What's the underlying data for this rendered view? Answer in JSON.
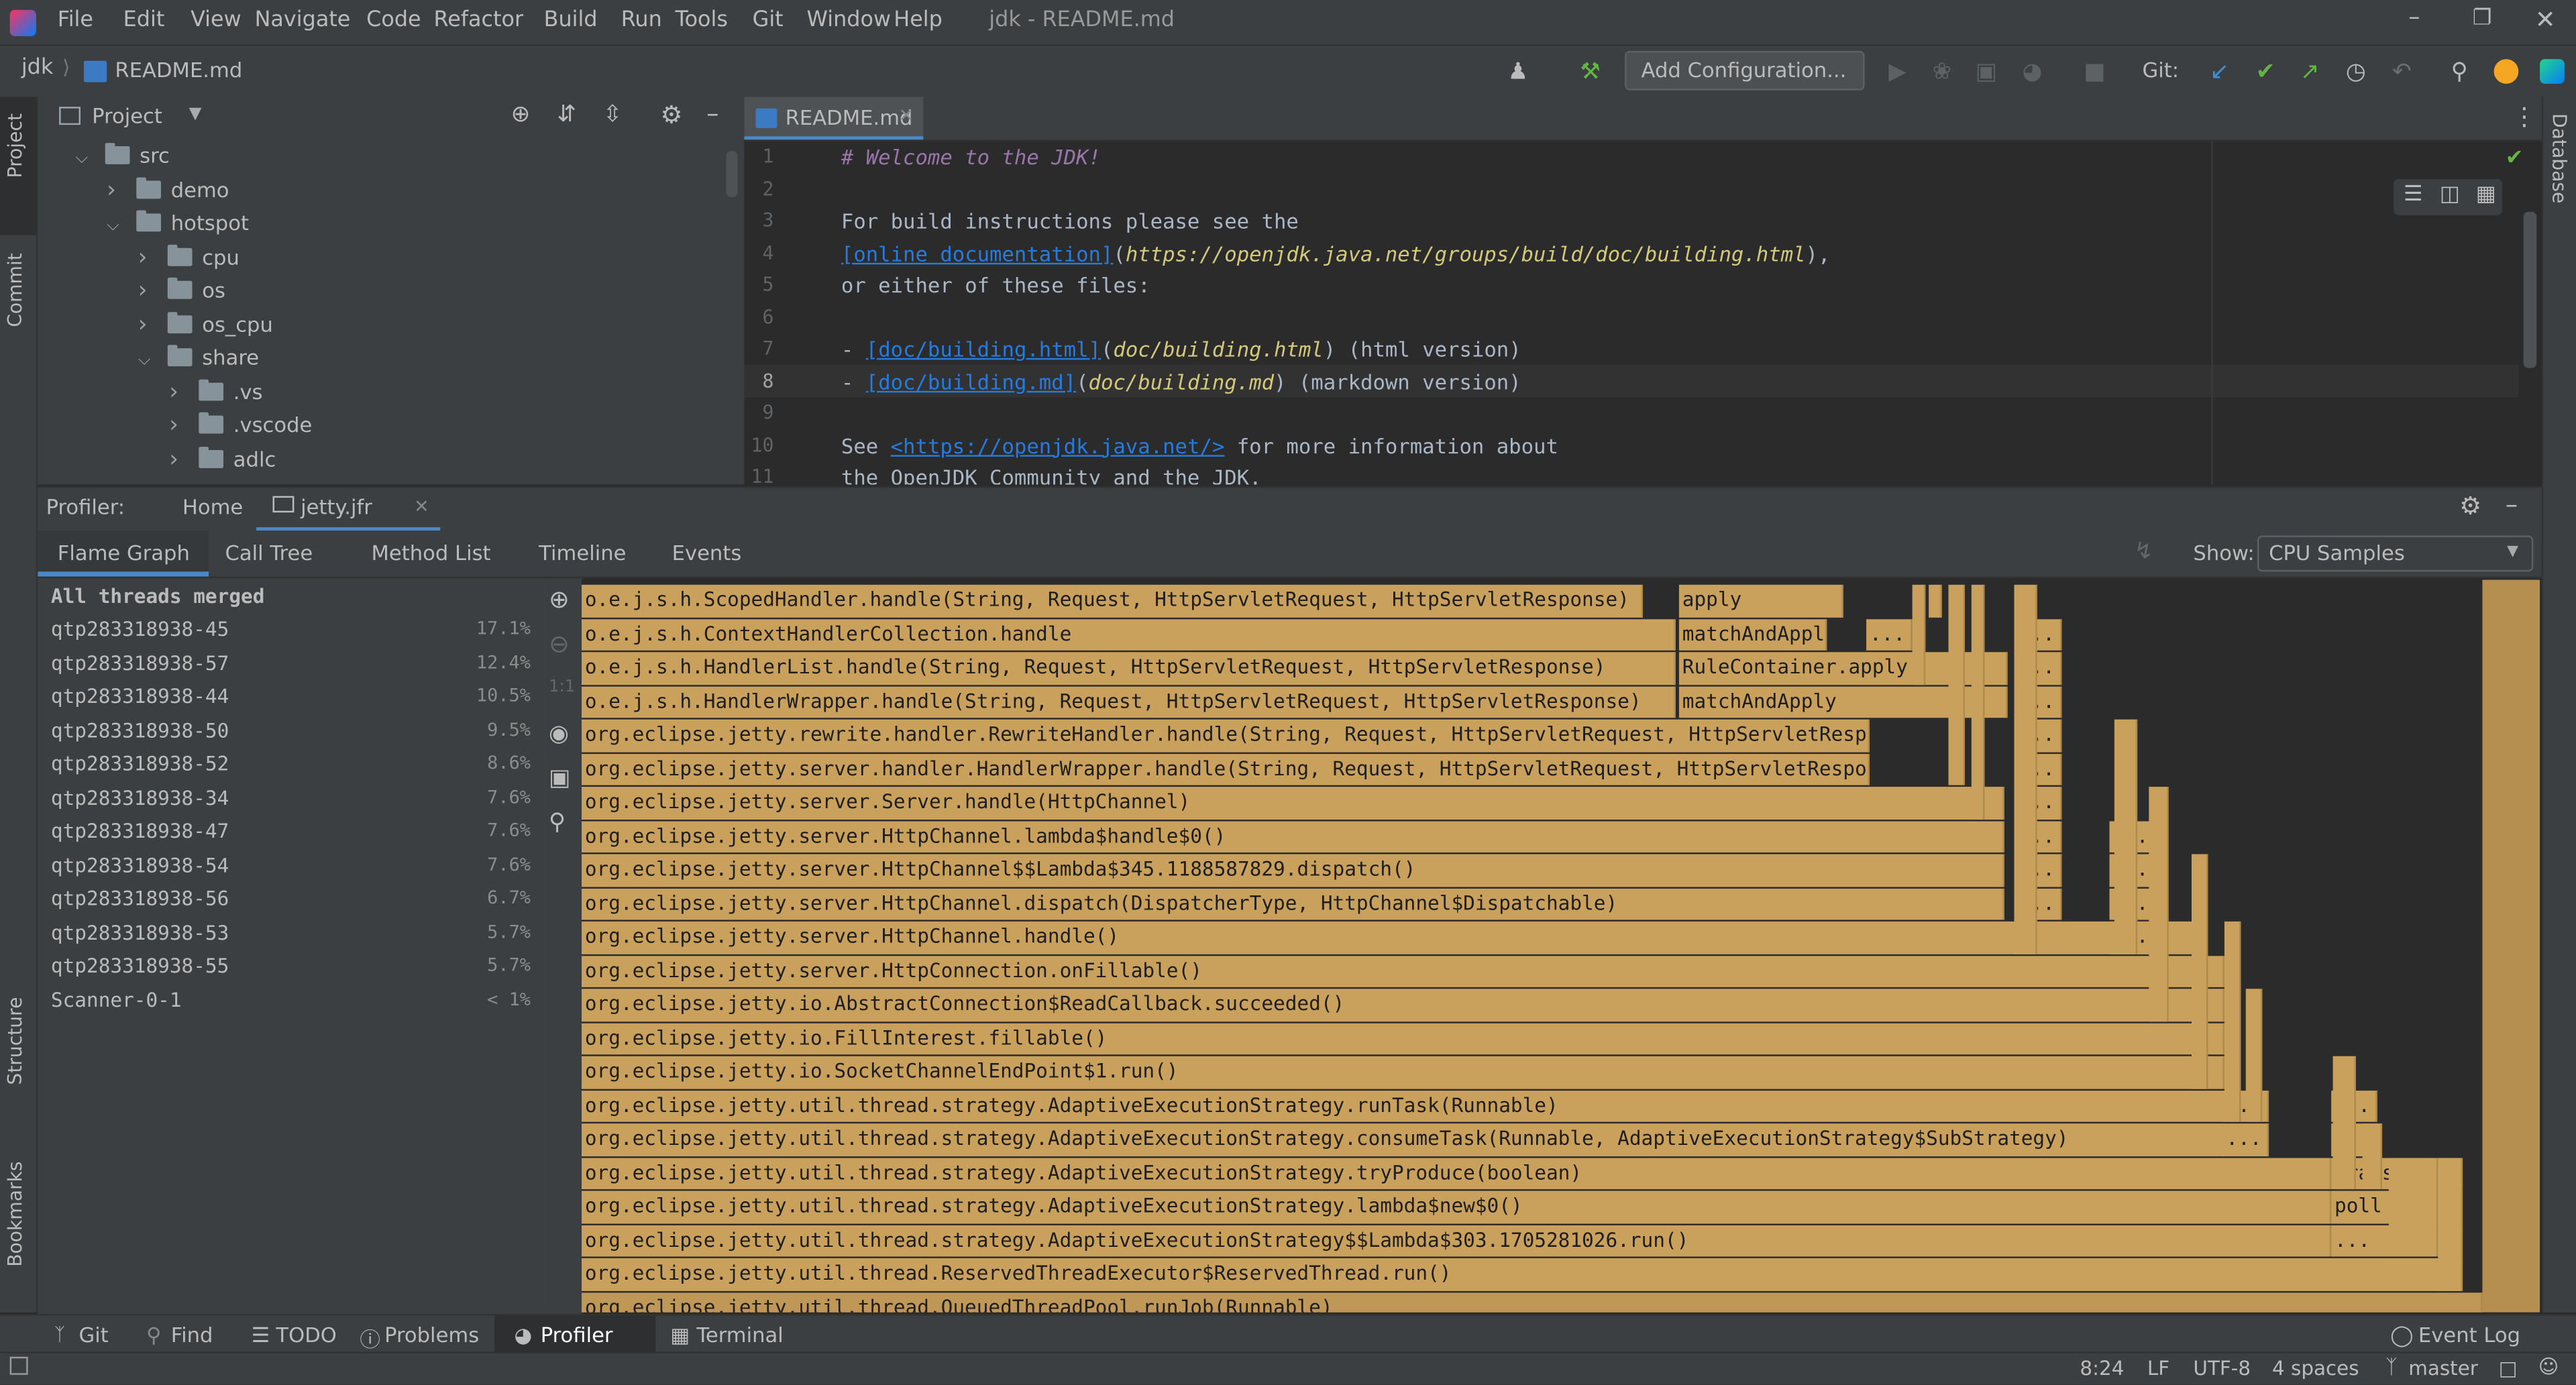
{
  "app": {
    "menu": [
      "File",
      "Edit",
      "View",
      "Navigate",
      "Code",
      "Refactor",
      "Build",
      "Run",
      "Tools",
      "Git",
      "Window",
      "Help"
    ],
    "window_title": "jdk - README.md"
  },
  "navbar": {
    "breadcrumb_project": "jdk",
    "breadcrumb_file": "README.md",
    "add_config_label": "Add Configuration...",
    "git_label": "Git:"
  },
  "project_panel": {
    "title": "Project",
    "tree": [
      {
        "label": "src",
        "depth": 0,
        "open": true
      },
      {
        "label": "demo",
        "depth": 1,
        "open": false
      },
      {
        "label": "hotspot",
        "depth": 1,
        "open": true
      },
      {
        "label": "cpu",
        "depth": 2,
        "open": false
      },
      {
        "label": "os",
        "depth": 2,
        "open": false
      },
      {
        "label": "os_cpu",
        "depth": 2,
        "open": false
      },
      {
        "label": "share",
        "depth": 2,
        "open": true
      },
      {
        "label": ".vs",
        "depth": 3,
        "open": false
      },
      {
        "label": ".vscode",
        "depth": 3,
        "open": false
      },
      {
        "label": "adlc",
        "depth": 3,
        "open": false
      }
    ]
  },
  "left_tabs": [
    "Project",
    "Commit",
    "Structure",
    "Bookmarks"
  ],
  "right_tabs": [
    "Database"
  ],
  "editor": {
    "tab_label": "README.md",
    "lines": [
      {
        "n": "1",
        "parts": [
          {
            "t": "# Welcome to the JDK!",
            "c": "heading"
          }
        ]
      },
      {
        "n": "2",
        "parts": []
      },
      {
        "n": "3",
        "parts": [
          {
            "t": "For build instructions please see the",
            "c": ""
          }
        ]
      },
      {
        "n": "4",
        "parts": [
          {
            "t": "[online documentation]",
            "c": "link"
          },
          {
            "t": "(",
            "c": ""
          },
          {
            "t": "https://openjdk.java.net/groups/build/doc/building.html",
            "c": "url"
          },
          {
            "t": "),",
            "c": ""
          }
        ]
      },
      {
        "n": "5",
        "parts": [
          {
            "t": "or either of these files:",
            "c": ""
          }
        ]
      },
      {
        "n": "6",
        "parts": []
      },
      {
        "n": "7",
        "parts": [
          {
            "t": "- ",
            "c": ""
          },
          {
            "t": "[doc/building.html]",
            "c": "link"
          },
          {
            "t": "(",
            "c": ""
          },
          {
            "t": "doc/building.html",
            "c": "url"
          },
          {
            "t": ") (html version)",
            "c": ""
          }
        ]
      },
      {
        "n": "8",
        "parts": [
          {
            "t": "- ",
            "c": ""
          },
          {
            "t": "[doc/building.md]",
            "c": "link"
          },
          {
            "t": "(",
            "c": ""
          },
          {
            "t": "doc/building.md",
            "c": "url"
          },
          {
            "t": ") (markdown version)",
            "c": ""
          }
        ]
      },
      {
        "n": "9",
        "parts": []
      },
      {
        "n": "10",
        "parts": [
          {
            "t": "See ",
            "c": ""
          },
          {
            "t": "<https://openjdk.java.net/>",
            "c": "link"
          },
          {
            "t": " for more information about",
            "c": ""
          }
        ]
      },
      {
        "n": "11",
        "parts": [
          {
            "t": "the OpenJDK Community and the JDK.",
            "c": ""
          }
        ]
      }
    ]
  },
  "profiler": {
    "label": "Profiler:",
    "home_tab": "Home",
    "file_tab": "jetty.jfr",
    "view_tabs": [
      "Flame Graph",
      "Call Tree",
      "Method List",
      "Timeline",
      "Events"
    ],
    "show_label": "Show:",
    "show_value": "CPU Samples",
    "threads_header": "All threads merged",
    "threads": [
      {
        "name": "qtp283318938-45",
        "pct": "17.1%"
      },
      {
        "name": "qtp283318938-57",
        "pct": "12.4%"
      },
      {
        "name": "qtp283318938-44",
        "pct": "10.5%"
      },
      {
        "name": "qtp283318938-50",
        "pct": "9.5%"
      },
      {
        "name": "qtp283318938-52",
        "pct": "8.6%"
      },
      {
        "name": "qtp283318938-34",
        "pct": "7.6%"
      },
      {
        "name": "qtp283318938-47",
        "pct": "7.6%"
      },
      {
        "name": "qtp283318938-54",
        "pct": "7.6%"
      },
      {
        "name": "qtp283318938-56",
        "pct": "6.7%"
      },
      {
        "name": "qtp283318938-53",
        "pct": "5.7%"
      },
      {
        "name": "qtp283318938-55",
        "pct": "5.7%"
      },
      {
        "name": "Scanner-0-1",
        "pct": "< 1%"
      }
    ],
    "frames": [
      "o.e.j.s.h.ScopedHandler.handle(String, Request, HttpServletRequest, HttpServletResponse)",
      "o.e.j.s.h.ContextHandlerCollection.handle",
      "o.e.j.s.h.HandlerList.handle(String, Request, HttpServletRequest, HttpServletResponse)",
      "o.e.j.s.h.HandlerWrapper.handle(String, Request, HttpServletRequest, HttpServletResponse)",
      "org.eclipse.jetty.rewrite.handler.RewriteHandler.handle(String, Request, HttpServletRequest, HttpServletResponse)",
      "org.eclipse.jetty.server.handler.HandlerWrapper.handle(String, Request, HttpServletRequest, HttpServletResponse)",
      "org.eclipse.jetty.server.Server.handle(HttpChannel)",
      "org.eclipse.jetty.server.HttpChannel.lambda$handle$0()",
      "org.eclipse.jetty.server.HttpChannel$$Lambda$345.1188587829.dispatch()",
      "org.eclipse.jetty.server.HttpChannel.dispatch(DispatcherType, HttpChannel$Dispatchable)",
      "org.eclipse.jetty.server.HttpChannel.handle()",
      "org.eclipse.jetty.server.HttpConnection.onFillable()",
      "org.eclipse.jetty.io.AbstractConnection$ReadCallback.succeeded()",
      "org.eclipse.jetty.io.FillInterest.fillable()",
      "org.eclipse.jetty.io.SocketChannelEndPoint$1.run()",
      "org.eclipse.jetty.util.thread.strategy.AdaptiveExecutionStrategy.runTask(Runnable)",
      "org.eclipse.jetty.util.thread.strategy.AdaptiveExecutionStrategy.consumeTask(Runnable, AdaptiveExecutionStrategy$SubStrategy)",
      "org.eclipse.jetty.util.thread.strategy.AdaptiveExecutionStrategy.tryProduce(boolean)",
      "org.eclipse.jetty.util.thread.strategy.AdaptiveExecutionStrategy.lambda$new$0()",
      "org.eclipse.jetty.util.thread.strategy.AdaptiveExecutionStrategy$$Lambda$303.1705281026.run()",
      "org.eclipse.jetty.util.thread.ReservedThreadExecutor$ReservedThread.run()",
      "org.eclipse.jetty.util.thread.QueuedThreadPool.runJob(Runnable)"
    ],
    "side_frames": {
      "apply": "apply",
      "matchAndApply": "matchAndApply",
      "ellipsis": "...",
      "rulecontainer": "RuleContainer.apply",
      "transfer": "transfer",
      "poll": "poll"
    }
  },
  "bottom_tabs": [
    "Git",
    "Find",
    "TODO",
    "Problems",
    "Profiler",
    "Terminal"
  ],
  "event_log": "Event Log",
  "status": {
    "position": "8:24",
    "line_sep": "LF",
    "encoding": "UTF-8",
    "indent": "4 spaces",
    "branch": "master"
  }
}
